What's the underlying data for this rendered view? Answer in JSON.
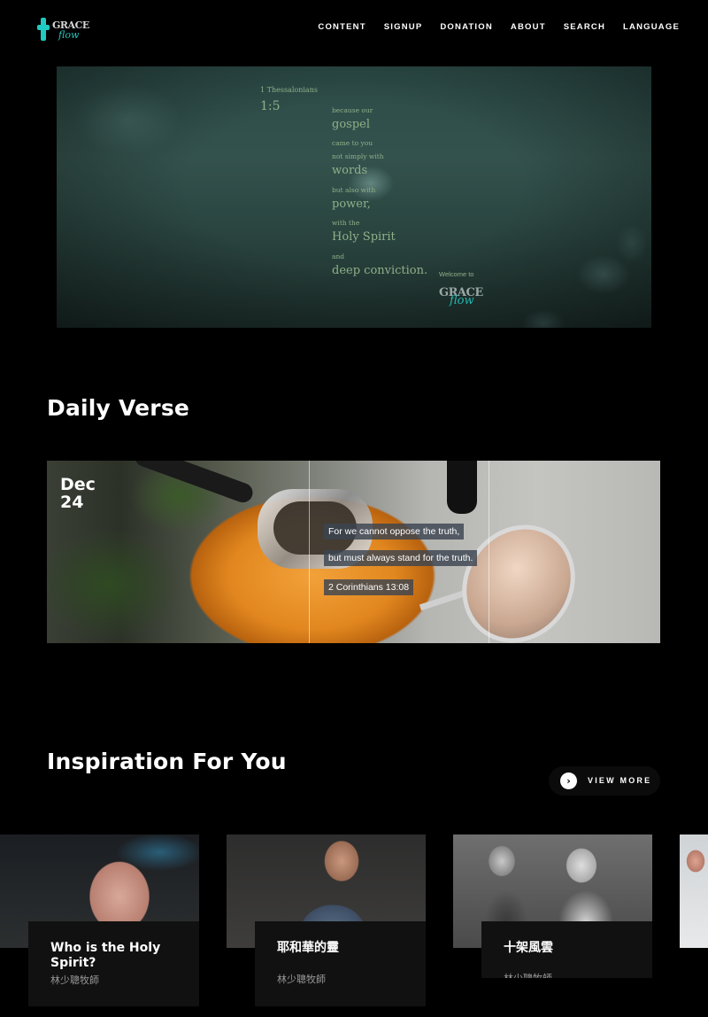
{
  "header": {
    "logo": {
      "grace": "GRACE",
      "flow": "flow"
    },
    "nav": [
      "CONTENT",
      "SIGNUP",
      "DONATION",
      "ABOUT",
      "SEARCH",
      "LANGUAGE"
    ]
  },
  "hero": {
    "reference": "1 Thessalonians",
    "ref_number": "1:5",
    "lines": [
      {
        "text": "because our",
        "style": "small"
      },
      {
        "text": "gospel",
        "style": "big"
      },
      {
        "text": "came to you",
        "style": "small"
      },
      {
        "text": "not simply with",
        "style": "small"
      },
      {
        "text": "words",
        "style": "big"
      },
      {
        "text": "but also with",
        "style": "small"
      },
      {
        "text": "power,",
        "style": "big"
      },
      {
        "text": "with the",
        "style": "small"
      },
      {
        "text": "Holy Spirit",
        "style": "big"
      },
      {
        "text": "and",
        "style": "small"
      },
      {
        "text": "deep conviction.",
        "style": "big"
      }
    ],
    "welcome": "Welcome to",
    "logo": {
      "grace": "GRACE",
      "flow": "flow"
    }
  },
  "daily_verse": {
    "title": "Daily Verse",
    "month": "Dec",
    "day": "24",
    "line1": "For we cannot oppose the truth,",
    "line2": "but must always stand for the truth.",
    "reference": "2 Corinthians 13:08"
  },
  "inspiration": {
    "title": "Inspiration For You",
    "view_more": "VIEW MORE",
    "view_more_icon": "chevron-right-icon",
    "items": [
      {
        "title": "Who is the Holy Spirit?",
        "author": "林少聰牧師"
      },
      {
        "title": "耶和華的靈",
        "author": "林少聰牧師"
      },
      {
        "title": "十架風雲",
        "author": "林少聰牧師"
      }
    ]
  },
  "colors": {
    "accent": "#20c9c2",
    "hero_text": "#8fb089",
    "background": "#000000"
  }
}
